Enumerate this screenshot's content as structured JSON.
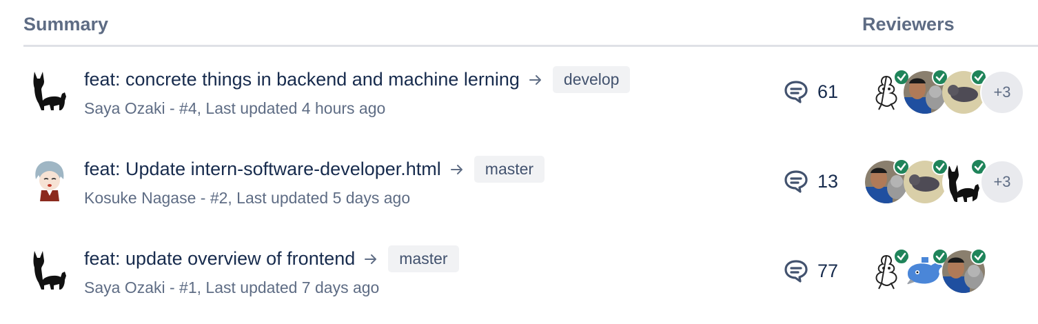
{
  "header": {
    "summary_label": "Summary",
    "reviewers_label": "Reviewers"
  },
  "pull_requests": [
    {
      "title": "feat: concrete things in backend and machine lerning",
      "branch": "develop",
      "meta": "Saya Ozaki - #4, Last updated 4 hours ago",
      "comments": "61",
      "author_avatar": "black-cat",
      "reviewers": [
        "sketch-character",
        "person-with-cat",
        "cat-on-floor"
      ],
      "more_reviewers": "+3"
    },
    {
      "title": "feat: Update intern-software-developer.html",
      "branch": "master",
      "meta": "Kosuke Nagase - #2, Last updated 5 days ago",
      "comments": "13",
      "author_avatar": "anime-girl",
      "reviewers": [
        "person-with-cat",
        "cat-on-floor",
        "black-cat"
      ],
      "more_reviewers": "+3"
    },
    {
      "title": "feat: update overview of frontend",
      "branch": "master",
      "meta": "Saya Ozaki - #1, Last updated 7 days ago",
      "comments": "77",
      "author_avatar": "black-cat",
      "reviewers": [
        "sketch-character",
        "blue-whale",
        "person-with-cat"
      ],
      "more_reviewers": ""
    }
  ],
  "colors": {
    "approved": "#1f845a",
    "text": "#172b4d",
    "subtle": "#5e6c84",
    "branch_bg": "#f1f2f4"
  }
}
